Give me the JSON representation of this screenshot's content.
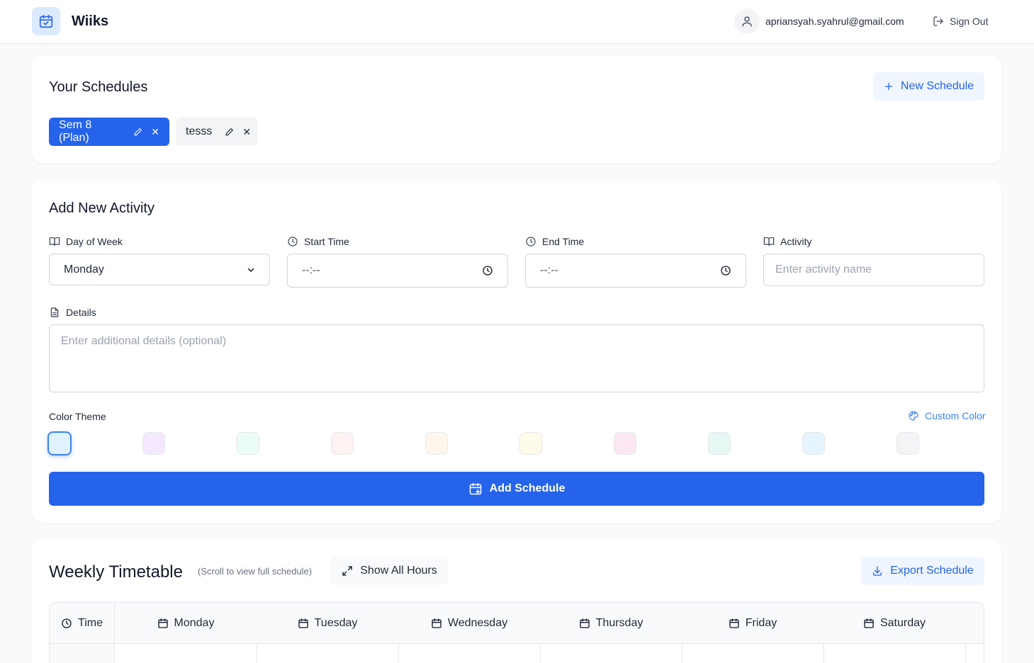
{
  "app": {
    "name": "Wiiks",
    "user_email": "apriansyah.syahrul@gmail.com",
    "sign_out_label": "Sign Out"
  },
  "schedules": {
    "title": "Your Schedules",
    "new_button_label": "New Schedule",
    "items": [
      {
        "name": "Sem 8 (Plan)",
        "active": true
      },
      {
        "name": "tesss",
        "active": false
      }
    ]
  },
  "add_activity": {
    "title": "Add New Activity",
    "day_label": "Day of Week",
    "day_value": "Monday",
    "start_label": "Start Time",
    "start_value": "--:--",
    "end_label": "End Time",
    "end_value": "--:--",
    "activity_label": "Activity",
    "activity_placeholder": "Enter activity name",
    "details_label": "Details",
    "details_placeholder": "Enter additional details (optional)",
    "color_label": "Color Theme",
    "custom_color_label": "Custom Color",
    "colors": [
      "#e0f2fe",
      "#f3e8ff",
      "#ecfdf5",
      "#fef2f2",
      "#fff7ed",
      "#fefce8",
      "#fce7f3",
      "#e6f7f4",
      "#e6f4ff",
      "#f3f4f6"
    ],
    "submit_label": "Add Schedule"
  },
  "timetable": {
    "title": "Weekly Timetable",
    "subtitle": "(Scroll to view full schedule)",
    "show_hours_label": "Show All Hours",
    "export_label": "Export Schedule",
    "time_header": "Time",
    "days": [
      "Monday",
      "Tuesday",
      "Wednesday",
      "Thursday",
      "Friday",
      "Saturday"
    ]
  }
}
